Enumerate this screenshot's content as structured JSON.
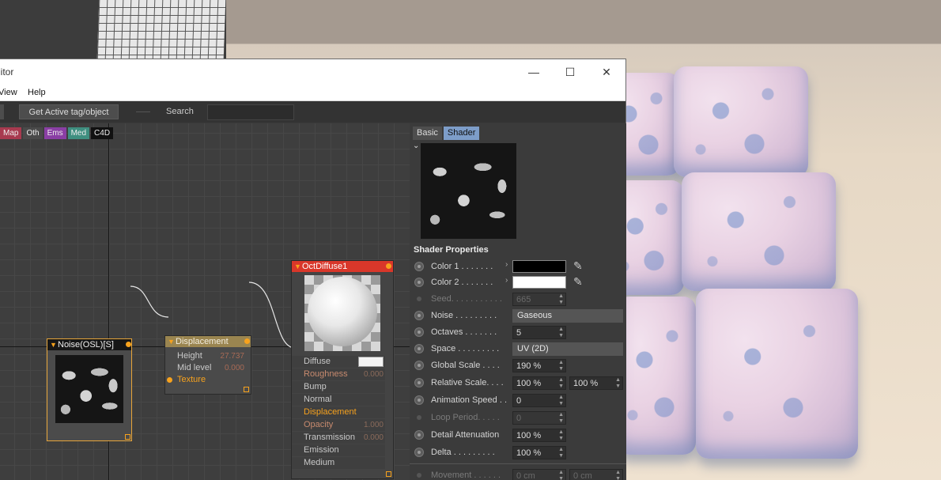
{
  "window": {
    "title_fragment": "litor",
    "minimize_glyph": "—",
    "maximize_glyph": "☐",
    "close_glyph": "✕"
  },
  "menu": [
    "View",
    "Help"
  ],
  "toolbar": {
    "get_active_label": "Get Active tag/object",
    "search_label": "Search",
    "search_value": ""
  },
  "categories": [
    {
      "label": "Map",
      "color": "#a83a4f"
    },
    {
      "label": "Oth",
      "color": "#4a4a4a"
    },
    {
      "label": "Ems",
      "color": "#8a3fa4"
    },
    {
      "label": "Med",
      "color": "#3f8f80"
    },
    {
      "label": "C4D",
      "color": "#111111"
    }
  ],
  "nodes": {
    "noise": {
      "title": "Noise(OSL)[S]"
    },
    "displacement": {
      "title": "Displacement",
      "params": [
        {
          "label": "Height",
          "value": "27.737"
        },
        {
          "label": "Mid level",
          "value": "0.000"
        },
        {
          "label": "Texture",
          "value": ""
        }
      ]
    },
    "octdiffuse": {
      "title": "OctDiffuse1",
      "inputs": [
        {
          "label": "Diffuse",
          "value": ""
        },
        {
          "label": "Roughness",
          "value": "0.000"
        },
        {
          "label": "Bump",
          "value": ""
        },
        {
          "label": "Normal",
          "value": ""
        },
        {
          "label": "Displacement",
          "value": ""
        },
        {
          "label": "Opacity",
          "value": "1.000"
        },
        {
          "label": "Transmission",
          "value": "0.000"
        },
        {
          "label": "Emission",
          "value": ""
        },
        {
          "label": "Medium",
          "value": ""
        }
      ]
    }
  },
  "panel": {
    "tabs": [
      "Basic",
      "Shader"
    ],
    "active_tab": "Shader",
    "section_title": "Shader Properties",
    "color1_label": "Color 1 . . . . . . .",
    "color1_value": "#000000",
    "color2_label": "Color 2 . . . . . . .",
    "color2_value": "#ffffff",
    "seed_label": "Seed. . . . . . . . . . .",
    "seed_value": "665",
    "noise_label": "Noise . . . . . . . . .",
    "noise_value": "Gaseous",
    "octaves_label": "Octaves . . . . . . .",
    "octaves_value": "5",
    "space_label": "Space . . . . . . . . .",
    "space_value": "UV (2D)",
    "global_scale_label": "Global Scale . . . .",
    "global_scale_value": "190 %",
    "relative_scale_label": "Relative Scale. . . .",
    "relative_scale_x": "100 %",
    "relative_scale_y": "100 %",
    "anim_speed_label": "Animation Speed . .",
    "anim_speed_value": "0",
    "loop_period_label": "Loop Period. . . . .",
    "loop_period_value": "0",
    "detail_att_label": "Detail Attenuation",
    "detail_att_value": "100 %",
    "delta_label": "Delta . . . . . . . . .",
    "delta_value": "100 %",
    "movement_label": "Movement . . . . . .",
    "movement_x": "0 cm",
    "movement_y": "0 cm"
  }
}
